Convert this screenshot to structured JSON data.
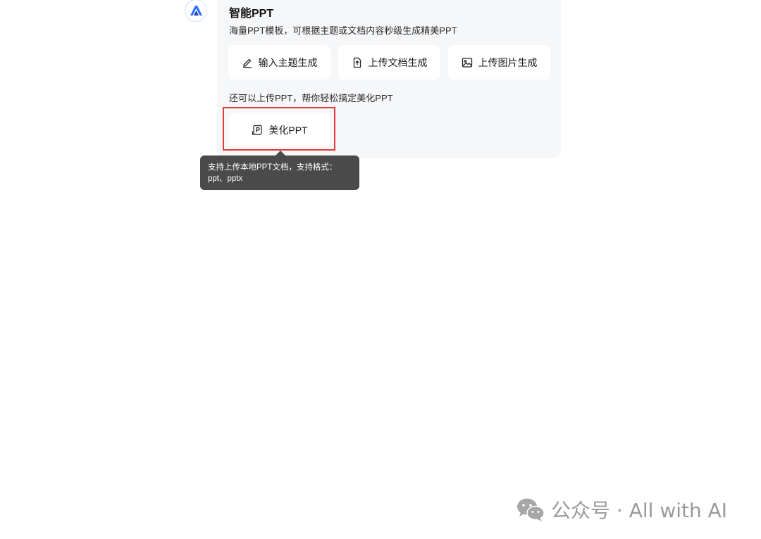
{
  "card": {
    "title": "智能PPT",
    "subtitle": "海量PPT模板，可根据主题或文档内容秒级生成精美PPT",
    "buttons": [
      {
        "label": "输入主题生成",
        "icon": "pen-icon"
      },
      {
        "label": "上传文档生成",
        "icon": "upload-file-icon"
      },
      {
        "label": "上传图片生成",
        "icon": "image-icon"
      }
    ],
    "hint": "还可以上传PPT，帮你轻松搞定美化PPT",
    "beautify": {
      "label": "美化PPT",
      "icon": "ppt-file-icon"
    }
  },
  "tooltip": {
    "line1": "支持上传本地PPT文档，支持格式：",
    "line2": "ppt、pptx"
  },
  "watermark": {
    "text": "公众号 · All with AI",
    "icon": "wechat-icon"
  },
  "colors": {
    "card_bg": "#f6f7f9",
    "highlight": "#e53935",
    "tooltip_bg": "#4a4a4a",
    "brand_blue": "#2f6bff"
  }
}
